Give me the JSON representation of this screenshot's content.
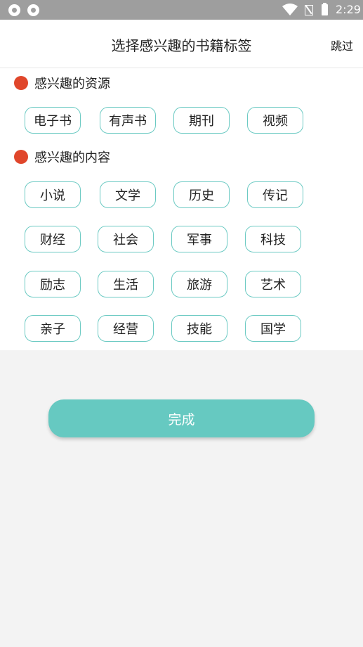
{
  "status_bar": {
    "time": "2:29",
    "icons": [
      "app-notification-icon",
      "app-notification-icon",
      "wifi-icon",
      "no-sim-icon",
      "battery-icon"
    ]
  },
  "header": {
    "title": "选择感兴趣的书籍标签",
    "skip_label": "跳过"
  },
  "sections": {
    "resources": {
      "label": "感兴趣的资源",
      "tags": [
        "电子书",
        "有声书",
        "期刊",
        "视频"
      ]
    },
    "content": {
      "label": "感兴趣的内容",
      "tags": [
        "小说",
        "文学",
        "历史",
        "传记",
        "财经",
        "社会",
        "军事",
        "科技",
        "励志",
        "生活",
        "旅游",
        "艺术",
        "亲子",
        "经营",
        "技能",
        "国学"
      ]
    }
  },
  "done_button": {
    "label": "完成"
  },
  "colors": {
    "accent": "#66c9c1",
    "chip_border": "#6ccac3",
    "section_dot": "#e0462b",
    "status_bar": "#9e9e9e"
  }
}
